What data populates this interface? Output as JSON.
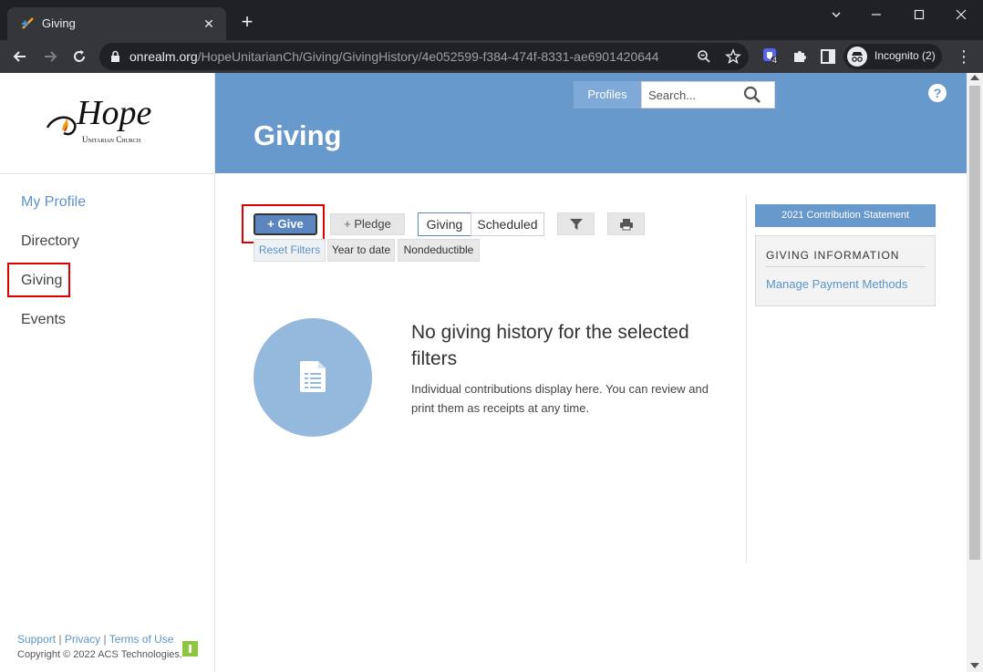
{
  "browser": {
    "tab_title": "Giving",
    "url_host": "onrealm.org",
    "url_path": "/HopeUnitarianCh/Giving/GivingHistory/4e052599-f384-474f-8331-ae6901420644",
    "extension_badge": "4",
    "incognito_label": "Incognito (2)"
  },
  "sidebar": {
    "logo_main": "Hope",
    "logo_sub": "Unitarian Church",
    "items": [
      {
        "label": "My Profile",
        "active": true
      },
      {
        "label": "Directory",
        "active": false
      },
      {
        "label": "Giving",
        "active": false
      },
      {
        "label": "Events",
        "active": false
      }
    ],
    "footer": {
      "support": "Support",
      "privacy": "Privacy",
      "terms": "Terms of Use",
      "separator": "|",
      "copyright": "Copyright © 2022 ACS Technologies."
    }
  },
  "header": {
    "title": "Giving",
    "profiles_label": "Profiles",
    "search_placeholder": "Search..."
  },
  "actions": {
    "give_label": "Give",
    "pledge_label": "Pledge",
    "toggle": [
      "Giving",
      "Scheduled"
    ],
    "filters": [
      "Reset Filters",
      "Year to date",
      "Nondeductible"
    ]
  },
  "empty_state": {
    "title": "No giving history for the selected filters",
    "description": "Individual contributions display here. You can review and print them as receipts at any time."
  },
  "right_panel": {
    "statement_button": "2021 Contribution Statement",
    "info_title": "GIVING INFORMATION",
    "manage_link": "Manage Payment Methods"
  },
  "colors": {
    "banner": "#6899cc",
    "accent": "#5b93c8",
    "highlight": "#e00000"
  }
}
